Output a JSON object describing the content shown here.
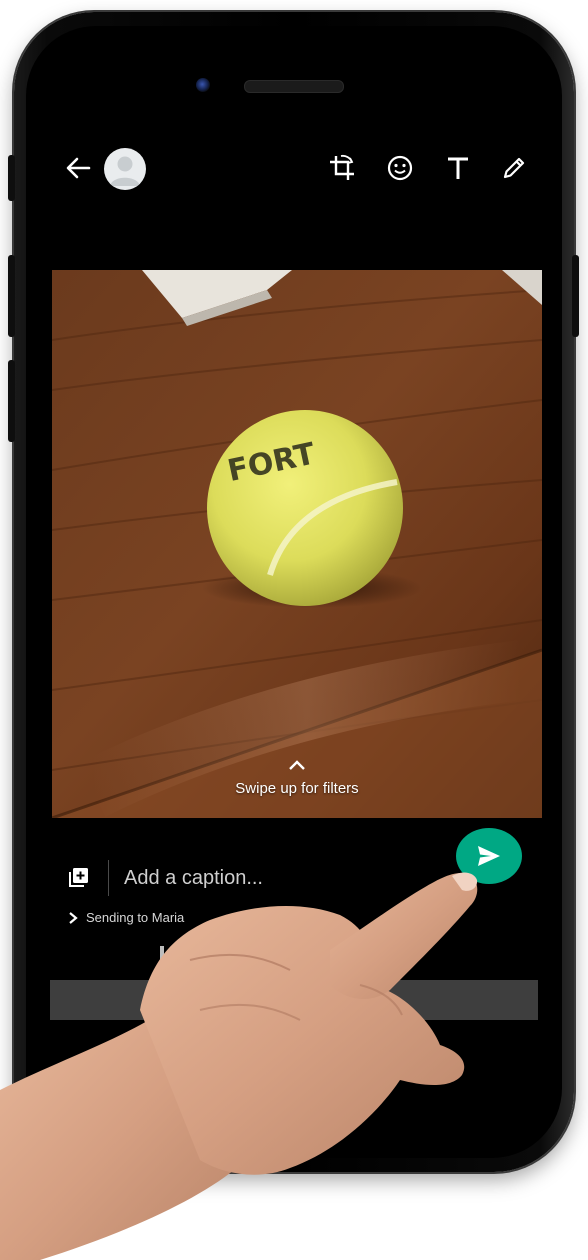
{
  "topbar": {
    "back_icon": "arrow-left-icon",
    "avatar_icon": "default-avatar-icon",
    "crop_icon": "crop-rotate-icon",
    "emoji_icon": "smiley-icon",
    "text_icon": "text-T-icon",
    "draw_icon": "pencil-icon"
  },
  "photo": {
    "subject": "tennis ball on wooden table",
    "ball_text": "FORT"
  },
  "filters": {
    "chevron_icon": "chevron-up-icon",
    "hint": "Swipe up for filters"
  },
  "caption": {
    "add_media_icon": "add-photo-icon",
    "placeholder": "Add a caption..."
  },
  "send": {
    "icon": "send-icon",
    "color": "#00a884"
  },
  "recipient": {
    "chevron_icon": "chevron-right-icon",
    "label": "Sending to Maria"
  },
  "colors": {
    "accent": "#00a884",
    "screen_bg": "#000000",
    "bottom_bar": "#3e3e3e"
  }
}
